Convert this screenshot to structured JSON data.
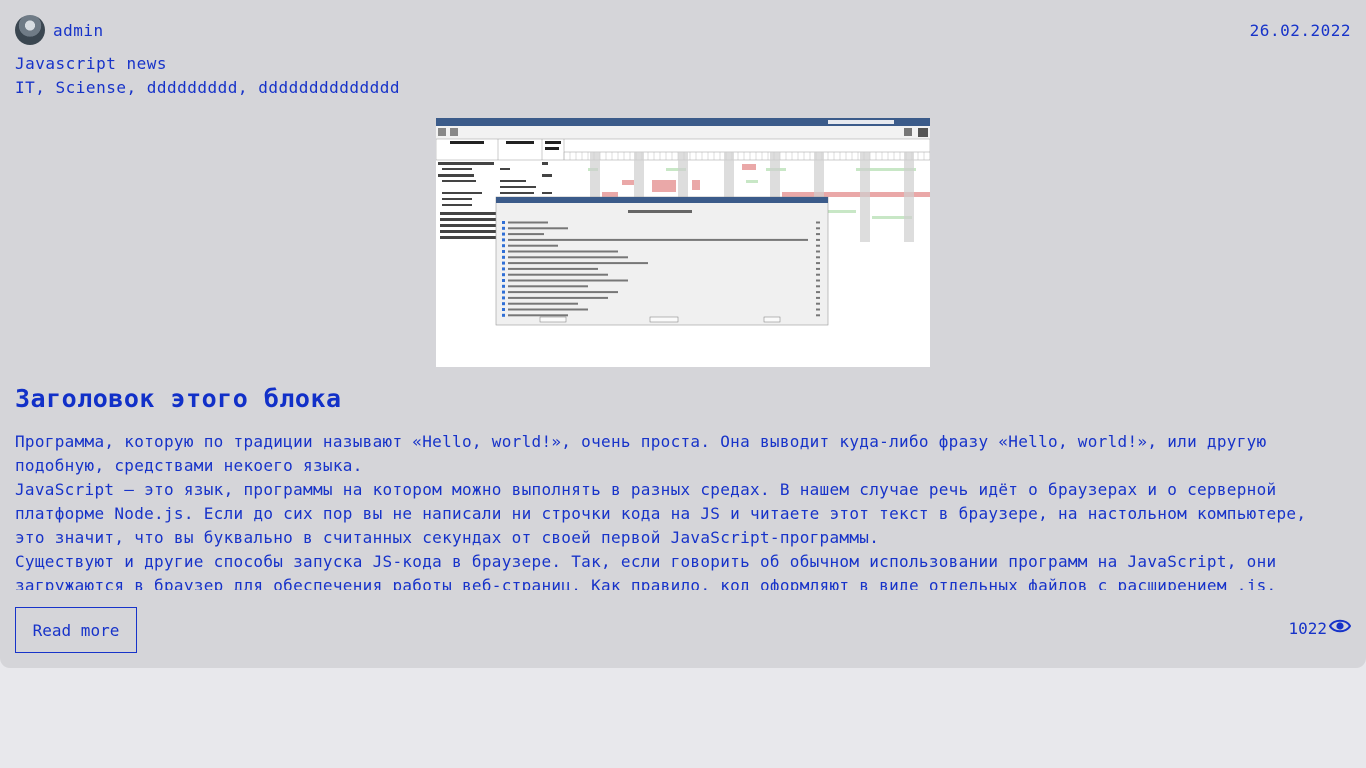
{
  "post": {
    "author": "admin",
    "date": "26.02.2022",
    "category": "Javascript news",
    "tags": "IT, Sciense, ddddddddd, dddddddddddddd",
    "title": "Заголовок этого блока",
    "paragraphs": [
      "Программа, которую по традиции называют «Hello, world!», очень проста. Она выводит куда-либо фразу «Hello, world!», или другую подобную, средствами некоего языка.",
      "JavaScript — это язык, программы на котором можно выполнять в разных средах. В нашем случае речь идёт о браузерах и о серверной платформе Node.js. Если до сих пор вы не написали ни строчки кода на JS и читаете этот текст в браузере, на настольном компьютере, это значит, что вы буквально в считанных секундах от своей первой JavaScript-программы.",
      "Существуют и другие способы запуска JS-кода в браузере. Так, если говорить об обычном использовании программ на JavaScript, они загружаются в браузер для обеспечения работы веб-страниц. Как правило, код оформляют в виде отдельных файлов с расширением .js."
    ],
    "read_more": "Read more",
    "views": "1022"
  },
  "icons": {
    "views": "eye-icon"
  },
  "colors": {
    "accent": "#1733c9",
    "card": "#d5d5d9",
    "page": "#e8e8ec"
  }
}
